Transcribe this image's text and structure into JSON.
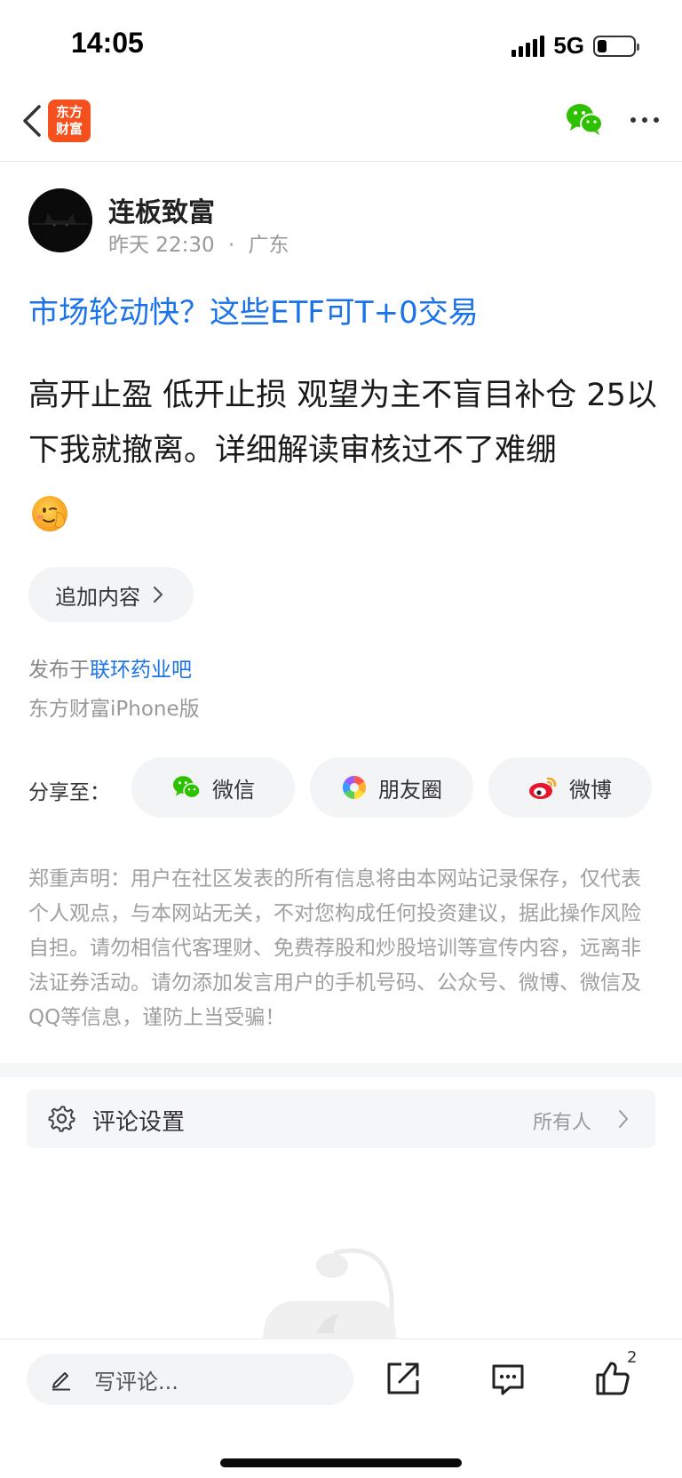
{
  "status_bar": {
    "time": "14:05",
    "network": "5G",
    "battery_level": 0.25
  },
  "nav": {
    "back_icon": "chevron-left-icon",
    "app_logo_lines": [
      "东方",
      "财富"
    ],
    "wechat_icon": "wechat-icon",
    "more_icon": "more-horizontal-icon",
    "brand_color": "#f4511e"
  },
  "post": {
    "author_name": "连板致富",
    "time": "昨天 22:30",
    "separator": "·",
    "location": "广东",
    "link_title": "市场轮动快？这些ETF可T+0交易",
    "body": "高开止盈 低开止损 观望为主不盲目补仓 25以下我就撤离。详细解读审核过不了难绷",
    "emoji_icon": "saluting-face-emoji",
    "append_label": "追加内容",
    "publish_prefix": "发布于",
    "bar_name": "联环药业吧",
    "client": "东方财富iPhone版"
  },
  "share": {
    "label": "分享至：",
    "wechat": "微信",
    "moments": "朋友圈",
    "weibo": "微博"
  },
  "disclaimer": "郑重声明：用户在社区发表的所有信息将由本网站记录保存，仅代表个人观点，与本网站无关，不对您构成任何投资建议，据此操作风险自担。请勿相信代客理财、免费荐股和炒股培训等宣传内容，远离非法证券活动。请勿添加发言用户的手机号码、公众号、微博、微信及QQ等信息，谨防上当受骗！",
  "comment_settings": {
    "label": "评论设置",
    "value": "所有人"
  },
  "bottom_bar": {
    "comment_placeholder": "写评论...",
    "like_count": "2"
  },
  "colors": {
    "link_blue": "#1a73e8",
    "wechat_green": "#2dc100"
  }
}
